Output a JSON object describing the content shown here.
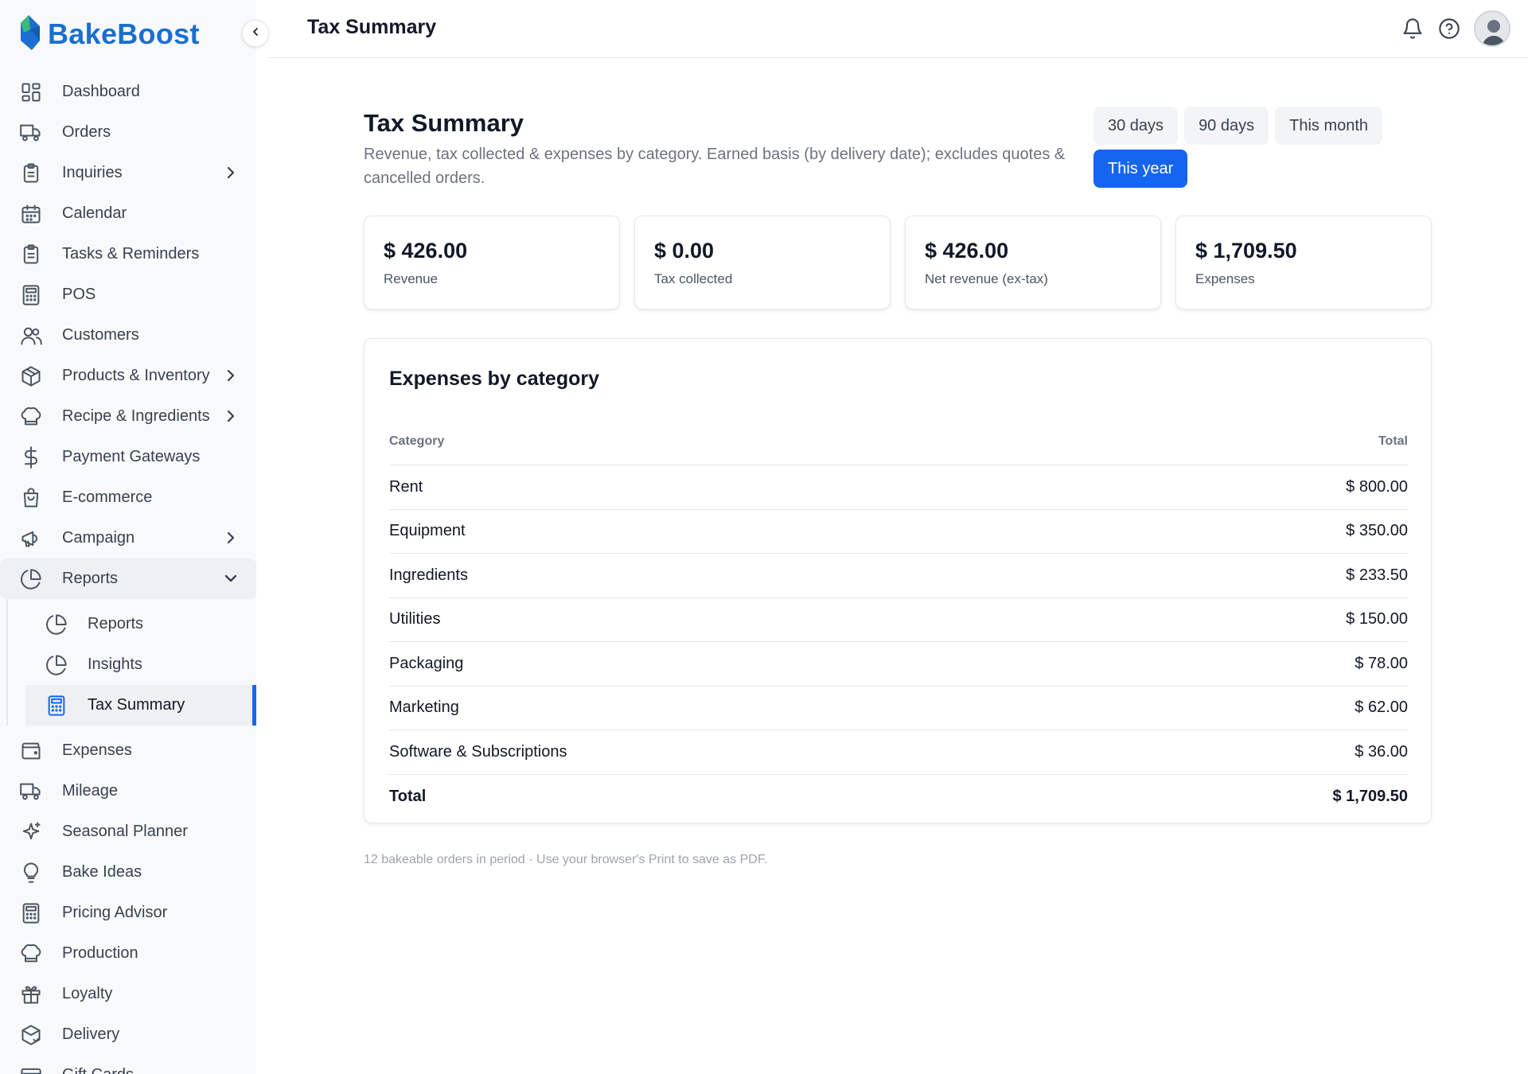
{
  "brand": {
    "name": "BakeBoost"
  },
  "header": {
    "title": "Tax Summary"
  },
  "sidebar": {
    "items": [
      {
        "label": "Dashboard",
        "icon": "dashboard-icon"
      },
      {
        "label": "Orders",
        "icon": "truck-icon"
      },
      {
        "label": "Inquiries",
        "icon": "clipboard-icon",
        "chevron": true
      },
      {
        "label": "Calendar",
        "icon": "calendar-icon"
      },
      {
        "label": "Tasks & Reminders",
        "icon": "clipboard-icon"
      },
      {
        "label": "POS",
        "icon": "calculator-icon"
      },
      {
        "label": "Customers",
        "icon": "users-icon"
      },
      {
        "label": "Products & Inventory",
        "icon": "box-icon",
        "chevron": true
      },
      {
        "label": "Recipe & Ingredients",
        "icon": "chef-hat-icon",
        "chevron": true
      },
      {
        "label": "Payment Gateways",
        "icon": "dollar-icon"
      },
      {
        "label": "E-commerce",
        "icon": "shopping-bag-icon"
      },
      {
        "label": "Campaign",
        "icon": "megaphone-icon",
        "chevron": true
      },
      {
        "label": "Reports",
        "icon": "pie-chart-icon",
        "open": true
      }
    ],
    "reports_sub": [
      {
        "label": "Reports",
        "icon": "pie-chart-icon"
      },
      {
        "label": "Insights",
        "icon": "pie-chart-icon"
      },
      {
        "label": "Tax Summary",
        "icon": "calculator-icon",
        "active": true
      }
    ],
    "items_after": [
      {
        "label": "Expenses",
        "icon": "wallet-icon"
      },
      {
        "label": "Mileage",
        "icon": "truck-icon"
      },
      {
        "label": "Seasonal Planner",
        "icon": "sparkles-icon"
      },
      {
        "label": "Bake Ideas",
        "icon": "lightbulb-icon"
      },
      {
        "label": "Pricing Advisor",
        "icon": "calculator-icon"
      },
      {
        "label": "Production",
        "icon": "chef-hat-icon"
      },
      {
        "label": "Loyalty",
        "icon": "gift-icon"
      },
      {
        "label": "Delivery",
        "icon": "package-check-icon"
      },
      {
        "label": "Gift Cards",
        "icon": "card-icon"
      }
    ]
  },
  "page": {
    "title": "Tax Summary",
    "subtitle": "Revenue, tax collected & expenses by category. Earned basis (by delivery date); excludes quotes & cancelled orders.",
    "ranges": [
      "30 days",
      "90 days",
      "This month",
      "This year"
    ],
    "active_range": "This year"
  },
  "stats": [
    {
      "value": "$ 426.00",
      "label": "Revenue"
    },
    {
      "value": "$ 0.00",
      "label": "Tax collected"
    },
    {
      "value": "$ 426.00",
      "label": "Net revenue (ex-tax)"
    },
    {
      "value": "$ 1,709.50",
      "label": "Expenses"
    }
  ],
  "expenses": {
    "title": "Expenses by category",
    "columns": [
      "Category",
      "Total"
    ],
    "rows": [
      {
        "category": "Rent",
        "total": "$ 800.00"
      },
      {
        "category": "Equipment",
        "total": "$ 350.00"
      },
      {
        "category": "Ingredients",
        "total": "$ 233.50"
      },
      {
        "category": "Utilities",
        "total": "$ 150.00"
      },
      {
        "category": "Packaging",
        "total": "$ 78.00"
      },
      {
        "category": "Marketing",
        "total": "$ 62.00"
      },
      {
        "category": "Software & Subscriptions",
        "total": "$ 36.00"
      }
    ],
    "total_label": "Total",
    "total_value": "$ 1,709.50"
  },
  "footnote": "12 bakeable orders in period · Use your browser's Print to save as PDF.",
  "colors": {
    "accent": "#1565f0",
    "brand": "#1a6fd0",
    "logo_green": "#3cb878"
  }
}
